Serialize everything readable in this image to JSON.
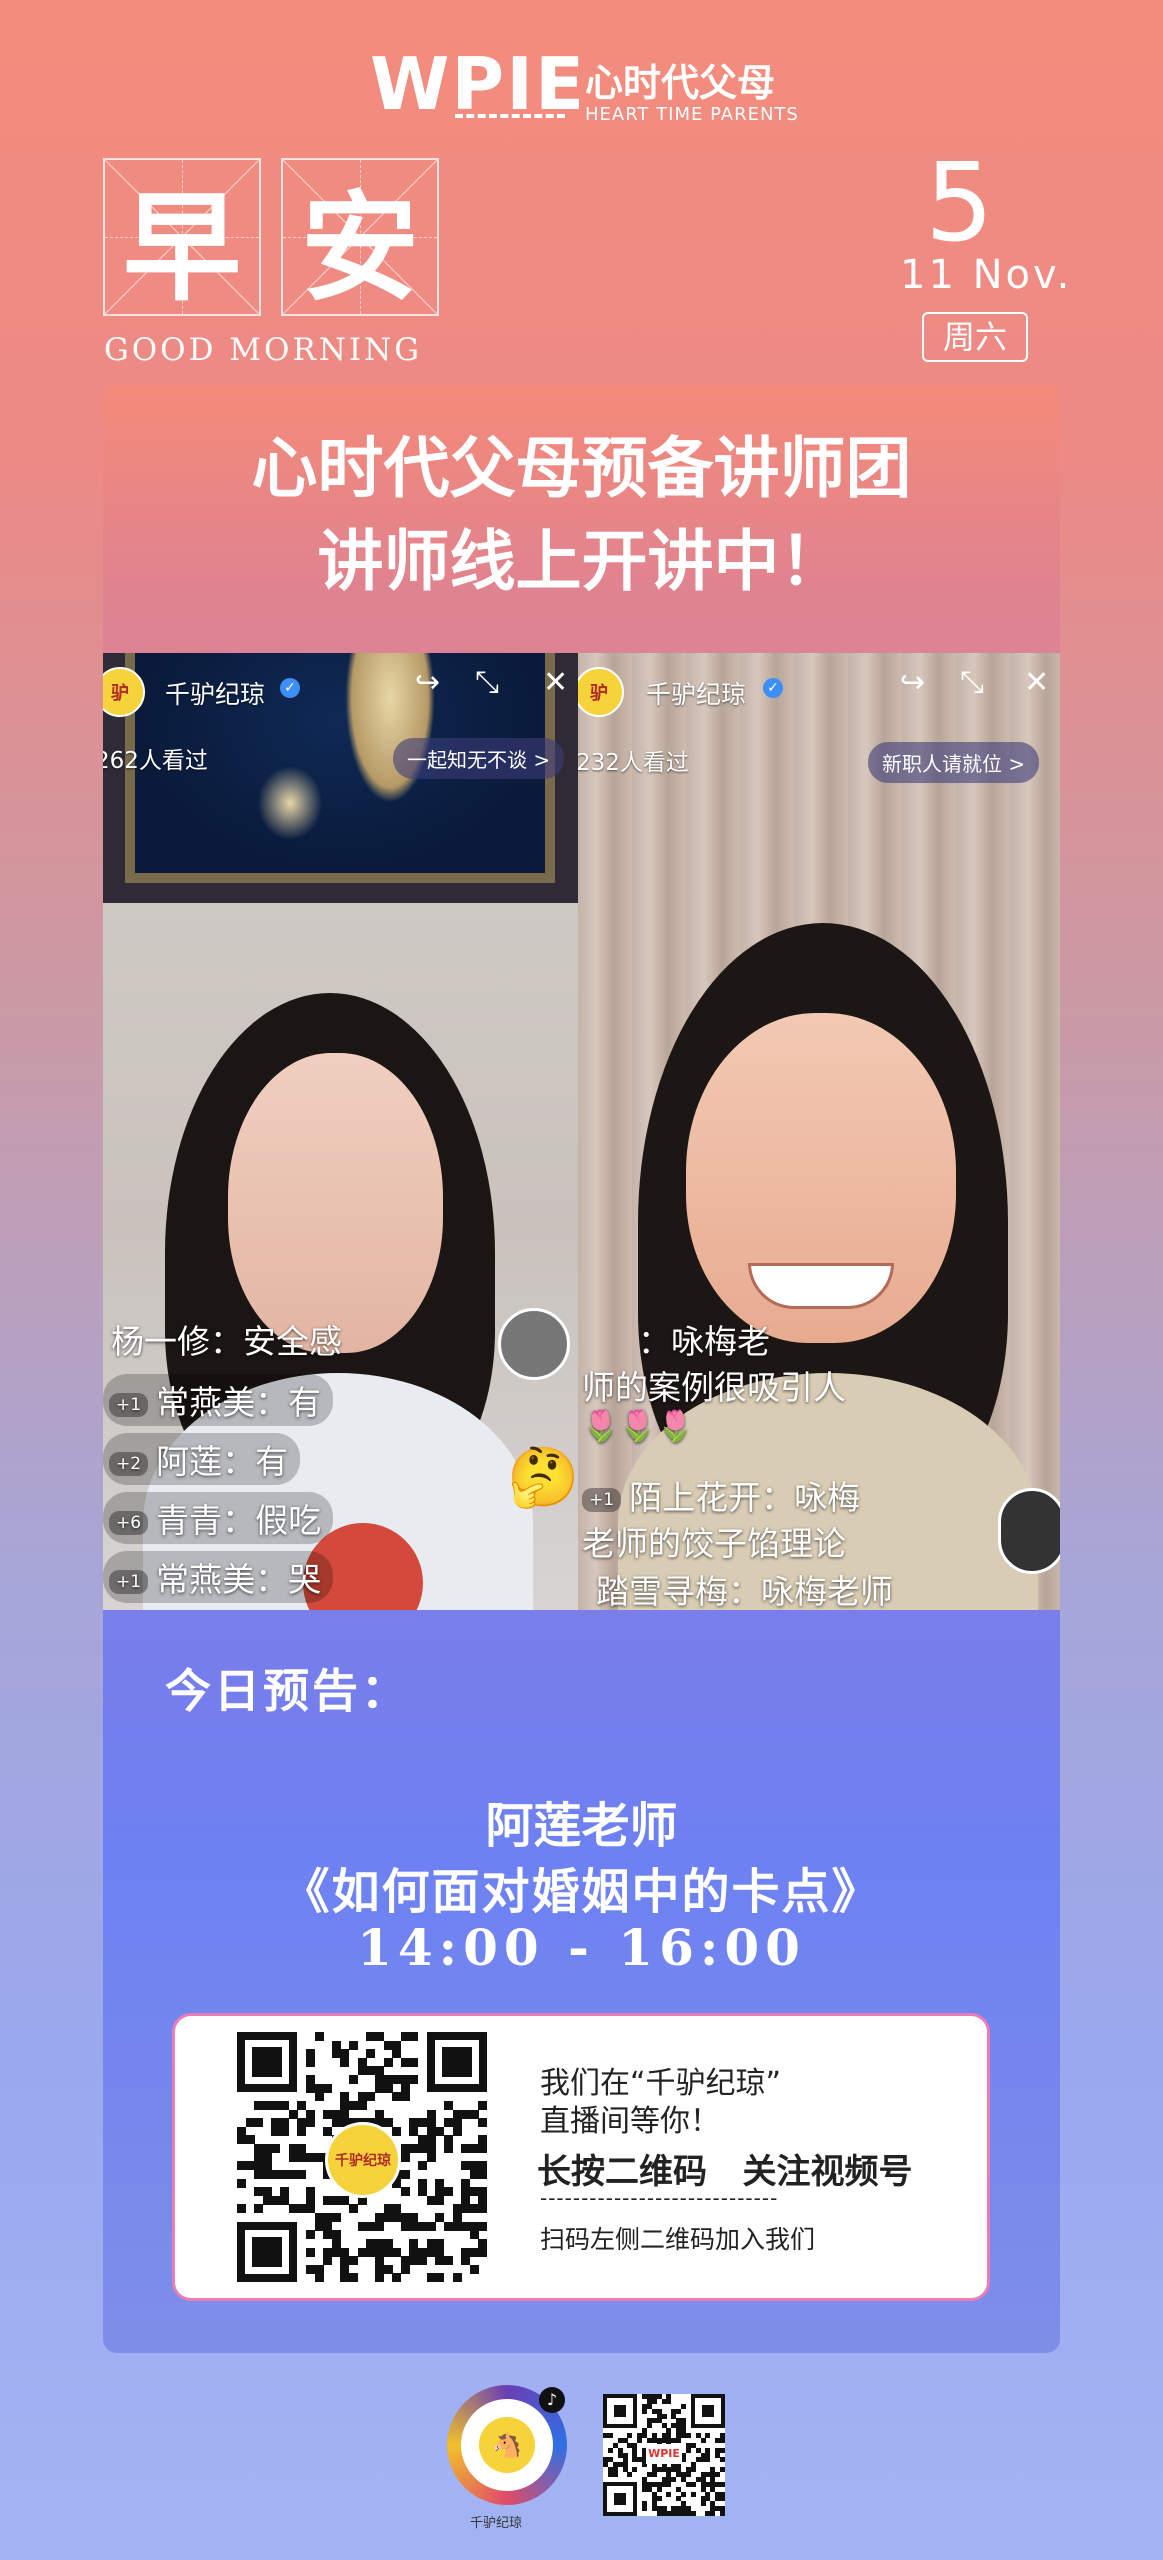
{
  "header": {
    "logo": "WPIE",
    "brand_cn": "心时代父母",
    "brand_en": "HEART TIME PARENTS",
    "greeting_chars": [
      "早",
      "安"
    ],
    "greeting_en": "GOOD MORNING",
    "date_day": "5",
    "date_month": "11  Nov.",
    "weekday": "周六"
  },
  "headline": {
    "line1": "心时代父母预备讲师团",
    "line2": "讲师线上开讲中！"
  },
  "live_left": {
    "account": "千驴纪琼",
    "views": "262人看过",
    "pill": "一起知无不谈 >",
    "comments": [
      {
        "tag": "",
        "text": "杨一修：安全感"
      },
      {
        "tag": "+1",
        "text": "常燕美：有"
      },
      {
        "tag": "+2",
        "text": "阿莲：有"
      },
      {
        "tag": "+6",
        "text": "青青：假吃"
      },
      {
        "tag": "+1",
        "text": "常燕美：哭"
      }
    ]
  },
  "live_right": {
    "account": "千驴纪琼",
    "views": "232人看过",
    "pill": "新职人请就位 >",
    "comments": [
      {
        "tag": "",
        "text": "：咏梅老"
      },
      {
        "tag": "",
        "text": "师的案例很吸引人"
      },
      {
        "tag": "",
        "text": "🌷🌷🌷"
      },
      {
        "tag": "+1",
        "text": "陌上花开：咏梅"
      },
      {
        "tag": "",
        "text": "老师的饺子馅理论"
      },
      {
        "tag": "",
        "text": "踏雪寻梅：咏梅老师"
      }
    ]
  },
  "preview": {
    "title": "今日预告：",
    "teacher": "阿莲老师",
    "topic": "《如何面对婚姻中的卡点》",
    "time": "14:00 - 16:00"
  },
  "card": {
    "line1": "我们在“千驴纪琼”",
    "line2": "直播间等你！",
    "line3": "长按二维码   关注视频号",
    "divider": "-----------------------------",
    "line4": "扫码左侧二维码加入我们",
    "qr_logo": "千驴纪琼"
  },
  "footer": {
    "caption": "千驴纪琼",
    "qr_label": "WPIE"
  },
  "colors": {
    "background_top": "#f38c7c",
    "background_bottom": "#a3b4f3",
    "card_border": "#ea7db6"
  }
}
